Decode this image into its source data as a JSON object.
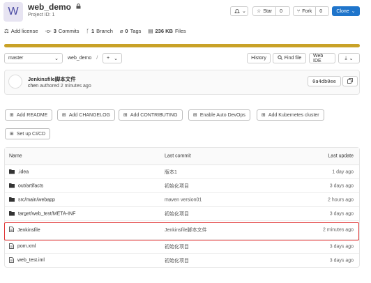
{
  "header": {
    "avatar_letter": "W",
    "project_name": "web_demo",
    "project_id": "Project ID: 1",
    "star_label": "Star",
    "star_count": "0",
    "fork_label": "Fork",
    "fork_count": "0",
    "clone_label": "Clone"
  },
  "stats": {
    "add_license": "Add license",
    "commits_count": "3",
    "commits_label": "Commits",
    "branch_count": "1",
    "branch_label": "Branch",
    "tags_count": "0",
    "tags_label": "Tags",
    "files_size": "236 KB",
    "files_label": "Files"
  },
  "toolbar": {
    "branch": "master",
    "path": "web_demo",
    "separator": "/",
    "add": "+",
    "history": "History",
    "find_file": "Find file",
    "web_ide": "Web IDE"
  },
  "last_commit": {
    "message": "Jenkinsfile脚本文件",
    "author": "chen",
    "action": "authored",
    "time": "2 minutes ago",
    "sha": "0a4db0ee"
  },
  "actions": [
    "Add README",
    "Add CHANGELOG",
    "Add CONTRIBUTING",
    "Enable Auto DevOps",
    "Add Kubernetes cluster",
    "Set up CI/CD"
  ],
  "table": {
    "headers": [
      "Name",
      "Last commit",
      "Last update"
    ],
    "rows": [
      {
        "type": "folder",
        "name": ".idea",
        "commit": "版本1",
        "updated": "1 day ago"
      },
      {
        "type": "folder",
        "name": "out/artifacts",
        "commit": "初始化项目",
        "updated": "3 days ago"
      },
      {
        "type": "folder",
        "name": "src/main/webapp",
        "commit": "maven version01",
        "updated": "2 hours ago"
      },
      {
        "type": "folder",
        "name": "target/web_test/META-INF",
        "commit": "初始化项目",
        "updated": "3 days ago"
      },
      {
        "type": "file",
        "name": "Jenkinsfile",
        "commit": "Jenkinsfile脚本文件",
        "updated": "2 minutes ago"
      },
      {
        "type": "file",
        "name": "pom.xml",
        "commit": "初始化项目",
        "updated": "3 days ago"
      },
      {
        "type": "file",
        "name": "web_test.iml",
        "commit": "初始化项目",
        "updated": "3 days ago"
      }
    ]
  },
  "colors": {
    "accent": "#1f75cb",
    "language_bar": "#c9a227",
    "highlight": "#e03131"
  }
}
